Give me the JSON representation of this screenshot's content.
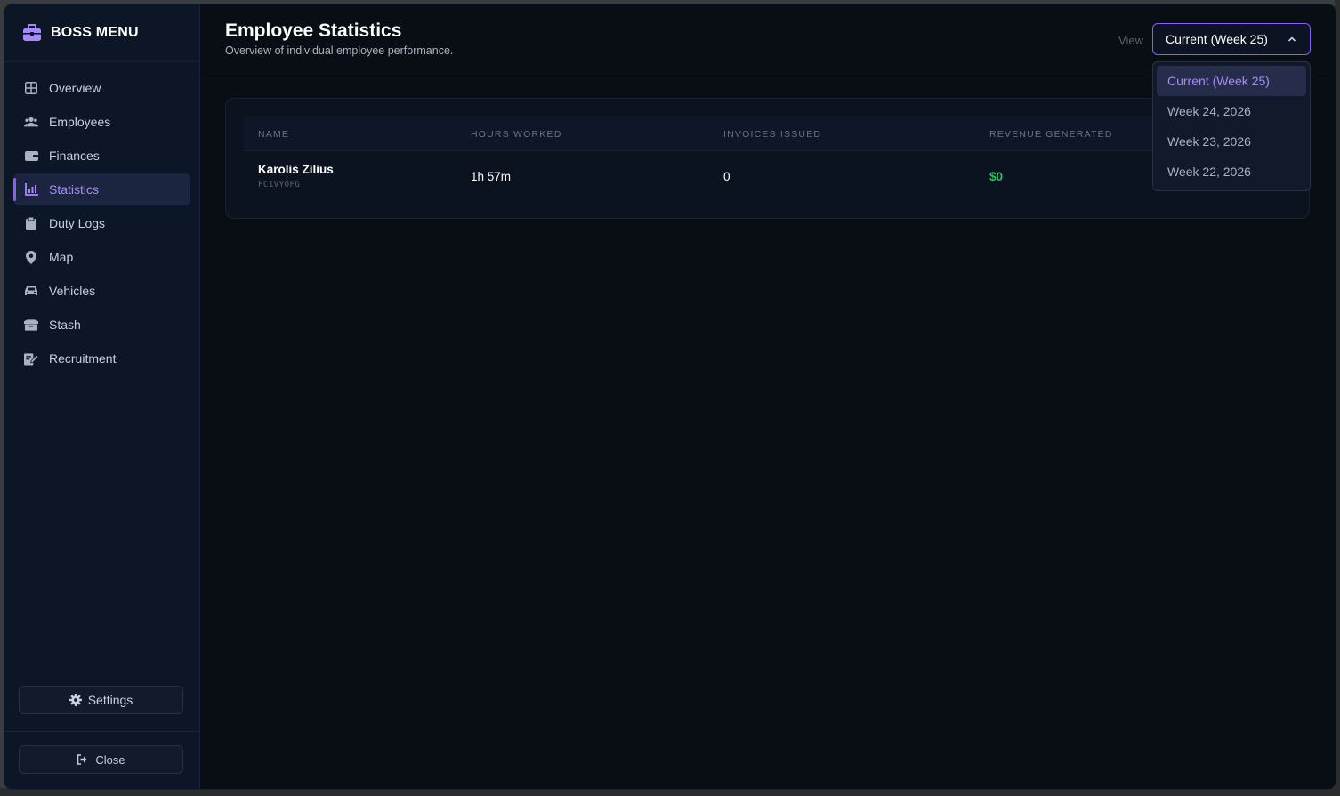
{
  "brand": {
    "title": "BOSS MENU",
    "icon": "briefcase-icon",
    "accent": "#a78bfa"
  },
  "sidebar": {
    "items": [
      {
        "label": "Overview",
        "icon": "grid-icon",
        "active": false
      },
      {
        "label": "Employees",
        "icon": "users-icon",
        "active": false
      },
      {
        "label": "Finances",
        "icon": "wallet-icon",
        "active": false
      },
      {
        "label": "Statistics",
        "icon": "chart-icon",
        "active": true
      },
      {
        "label": "Duty Logs",
        "icon": "clipboard-icon",
        "active": false
      },
      {
        "label": "Map",
        "icon": "map-pin-icon",
        "active": false
      },
      {
        "label": "Vehicles",
        "icon": "car-icon",
        "active": false
      },
      {
        "label": "Stash",
        "icon": "box-icon",
        "active": false
      },
      {
        "label": "Recruitment",
        "icon": "recruit-icon",
        "active": false
      }
    ],
    "settings_label": "Settings",
    "close_label": "Close"
  },
  "header": {
    "title": "Employee Statistics",
    "subtitle": "Overview of individual employee performance.",
    "view_label": "View",
    "selected_view": "Current (Week 25)"
  },
  "table": {
    "columns": [
      "NAME",
      "HOURS WORKED",
      "INVOICES ISSUED",
      "REVENUE GENERATED"
    ],
    "rows": [
      {
        "name": "Karolis Zilius",
        "id": "FC1VY0FG",
        "hours": "1h 57m",
        "invoices": "0",
        "revenue": "$0"
      }
    ]
  },
  "dropdown": {
    "options": [
      "Current (Week 25)",
      "Week 24, 2026",
      "Week 23, 2026",
      "Week 22, 2026"
    ],
    "selected_index": 0
  },
  "colors": {
    "revenue": "#22c55e",
    "active": "#8b5cf6"
  }
}
